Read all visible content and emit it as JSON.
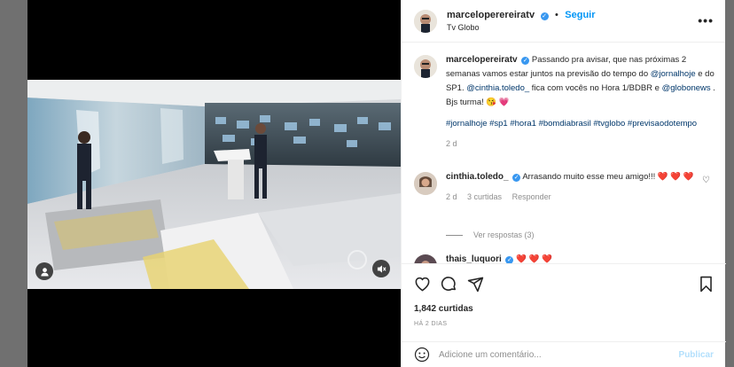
{
  "post": {
    "author": "marceloperereiratv",
    "follow_label": "Seguir",
    "dot": "•",
    "location": "Tv Globo",
    "more_label": "•••"
  },
  "caption": {
    "author": "marcelopereiratv",
    "text_1": "Passando pra avisar, que nas próximas 2 semanas vamos estar juntos na previsão do tempo do ",
    "mention_1": "@jornalhoje",
    "text_2": " e do SP1. ",
    "mention_2": "@cinthia.toledo_",
    "text_3": " fica com vocês no Hora 1/BDBR e ",
    "mention_3": "@globonews",
    "text_4": " . Bjs turma! 😘 💗",
    "hashtags": "#jornalhoje #sp1 #hora1 #bomdiabrasil #tvglobo #previsaodotempo",
    "age": "2 d"
  },
  "comments": [
    {
      "author": "cinthia.toledo_",
      "text": "Arrasando muito esse meu amigo!!! ❤️ ❤️ ❤️",
      "age": "2 d",
      "likes": "3 curtidas",
      "reply_label": "Responder",
      "replies_label": "Ver respostas (3)"
    },
    {
      "author": "thais_luquori",
      "text": "❤️ ❤️ ❤️"
    }
  ],
  "stats": {
    "likes": "1,842 curtidas",
    "posted": "HÁ 2 DIAS"
  },
  "composer": {
    "placeholder": "Adicione um comentário...",
    "publish_label": "Publicar"
  },
  "colors": {
    "accent": "#0095f6",
    "verified": "#3897f0",
    "heart": "#ed4956"
  },
  "icons": [
    "user-tag-icon",
    "mute-icon",
    "verified-icon",
    "more-icon",
    "heart-icon",
    "comment-icon",
    "share-icon",
    "bookmark-icon",
    "emoji-icon"
  ]
}
